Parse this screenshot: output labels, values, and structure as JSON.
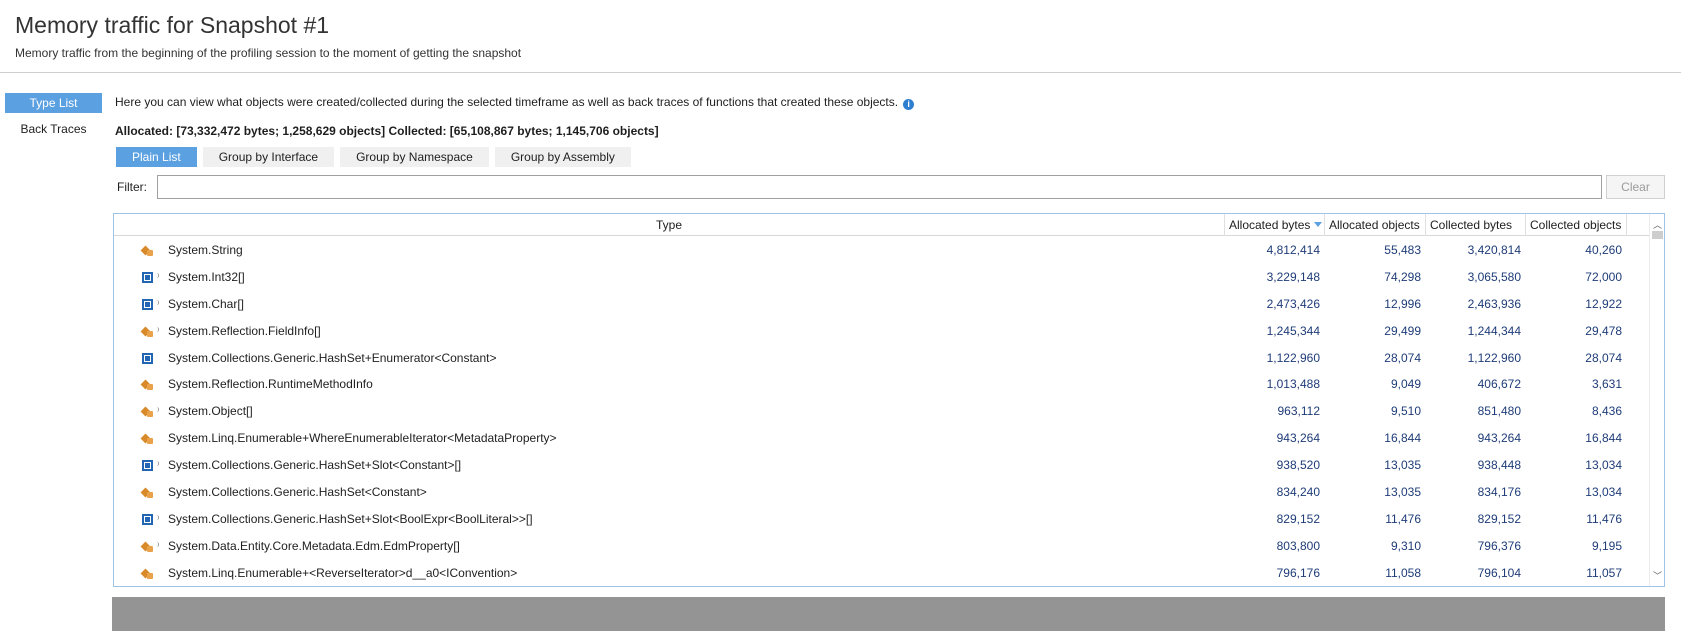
{
  "header": {
    "title": "Memory traffic for Snapshot #1",
    "subtitle": "Memory traffic from the beginning of the profiling session to the moment of getting the snapshot"
  },
  "nav": {
    "type_list": "Type List",
    "back_traces": "Back Traces"
  },
  "info_text": "Here you can view what objects were created/collected during the selected timeframe as well as back traces of functions that created these objects.",
  "summary": "Allocated: [73,332,472 bytes; 1,258,629 objects] Collected: [65,108,867 bytes; 1,145,706 objects]",
  "grouping": {
    "plain_list": "Plain List",
    "by_interface": "Group by Interface",
    "by_namespace": "Group by Namespace",
    "by_assembly": "Group by Assembly"
  },
  "filter": {
    "label": "Filter:",
    "value": "",
    "clear": "Clear"
  },
  "columns": {
    "type": "Type",
    "allocated_bytes": "Allocated bytes",
    "allocated_objects": "Allocated objects",
    "collected_bytes": "Collected bytes",
    "collected_objects": "Collected objects"
  },
  "rows": [
    {
      "type": "System.String",
      "icon": "class-icon",
      "pinned": false,
      "allocated_bytes": "4,812,414",
      "allocated_objects": "55,483",
      "collected_bytes": "3,420,814",
      "collected_objects": "40,260"
    },
    {
      "type": "System.Int32[]",
      "icon": "struct-icon",
      "pinned": true,
      "allocated_bytes": "3,229,148",
      "allocated_objects": "74,298",
      "collected_bytes": "3,065,580",
      "collected_objects": "72,000"
    },
    {
      "type": "System.Char[]",
      "icon": "struct-icon",
      "pinned": true,
      "allocated_bytes": "2,473,426",
      "allocated_objects": "12,996",
      "collected_bytes": "2,463,936",
      "collected_objects": "12,922"
    },
    {
      "type": "System.Reflection.FieldInfo[]",
      "icon": "class-icon",
      "pinned": true,
      "allocated_bytes": "1,245,344",
      "allocated_objects": "29,499",
      "collected_bytes": "1,244,344",
      "collected_objects": "29,478"
    },
    {
      "type": "System.Collections.Generic.HashSet+Enumerator<Constant>",
      "icon": "struct-icon",
      "pinned": false,
      "allocated_bytes": "1,122,960",
      "allocated_objects": "28,074",
      "collected_bytes": "1,122,960",
      "collected_objects": "28,074"
    },
    {
      "type": "System.Reflection.RuntimeMethodInfo",
      "icon": "class-icon",
      "pinned": false,
      "allocated_bytes": "1,013,488",
      "allocated_objects": "9,049",
      "collected_bytes": "406,672",
      "collected_objects": "3,631"
    },
    {
      "type": "System.Object[]",
      "icon": "class-icon",
      "pinned": true,
      "allocated_bytes": "963,112",
      "allocated_objects": "9,510",
      "collected_bytes": "851,480",
      "collected_objects": "8,436"
    },
    {
      "type": "System.Linq.Enumerable+WhereEnumerableIterator<MetadataProperty>",
      "icon": "class-icon",
      "pinned": false,
      "allocated_bytes": "943,264",
      "allocated_objects": "16,844",
      "collected_bytes": "943,264",
      "collected_objects": "16,844"
    },
    {
      "type": "System.Collections.Generic.HashSet+Slot<Constant>[]",
      "icon": "struct-icon",
      "pinned": true,
      "allocated_bytes": "938,520",
      "allocated_objects": "13,035",
      "collected_bytes": "938,448",
      "collected_objects": "13,034"
    },
    {
      "type": "System.Collections.Generic.HashSet<Constant>",
      "icon": "class-icon",
      "pinned": false,
      "allocated_bytes": "834,240",
      "allocated_objects": "13,035",
      "collected_bytes": "834,176",
      "collected_objects": "13,034"
    },
    {
      "type": "System.Collections.Generic.HashSet+Slot<BoolExpr<BoolLiteral>>[]",
      "icon": "struct-icon",
      "pinned": true,
      "allocated_bytes": "829,152",
      "allocated_objects": "11,476",
      "collected_bytes": "829,152",
      "collected_objects": "11,476"
    },
    {
      "type": "System.Data.Entity.Core.Metadata.Edm.EdmProperty[]",
      "icon": "class-icon",
      "pinned": true,
      "allocated_bytes": "803,800",
      "allocated_objects": "9,310",
      "collected_bytes": "796,376",
      "collected_objects": "9,195"
    },
    {
      "type": "System.Linq.Enumerable+<ReverseIterator>d__a0<IConvention>",
      "icon": "class-icon",
      "pinned": false,
      "allocated_bytes": "796,176",
      "allocated_objects": "11,058",
      "collected_bytes": "796,104",
      "collected_objects": "11,057"
    }
  ],
  "colors": {
    "accent": "#5ba0e0",
    "number_text": "#1e3c78",
    "class_icon": "#d88a2a",
    "struct_icon": "#2266b3",
    "bottom_panel": "#949494"
  }
}
